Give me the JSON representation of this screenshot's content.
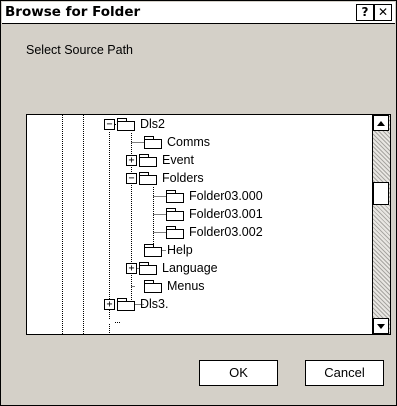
{
  "window": {
    "title": "Browse for Folder",
    "help_glyph": "?",
    "close_glyph": "✕"
  },
  "instruction": "Select Source Path",
  "tree": {
    "items": [
      {
        "label": "Dls2",
        "expander": "−"
      },
      {
        "label": "Comms",
        "expander": ""
      },
      {
        "label": "Event",
        "expander": "+"
      },
      {
        "label": "Folders",
        "expander": "−"
      },
      {
        "label": "Folder03.000",
        "expander": ""
      },
      {
        "label": "Folder03.001",
        "expander": ""
      },
      {
        "label": "Folder03.002",
        "expander": ""
      },
      {
        "label": "Help",
        "expander": ""
      },
      {
        "label": "Language",
        "expander": "+"
      },
      {
        "label": "Menus",
        "expander": ""
      },
      {
        "label": "Dls3.",
        "expander": "+"
      }
    ]
  },
  "buttons": {
    "ok": "OK",
    "cancel": "Cancel"
  }
}
